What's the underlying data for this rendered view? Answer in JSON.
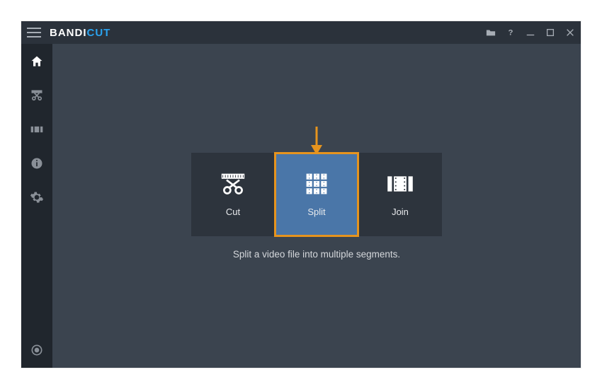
{
  "brand": {
    "part1": "BANDI",
    "part2": "CUT"
  },
  "titlebar": {
    "open": "Open",
    "help": "Help",
    "minimize": "Minimize",
    "maximize": "Maximize",
    "close": "Close"
  },
  "sidebar": {
    "home": "Home",
    "cut": "Cut",
    "join": "Join",
    "info": "Info",
    "settings": "Settings",
    "record": "Record"
  },
  "actions": {
    "cut": {
      "label": "Cut"
    },
    "split": {
      "label": "Split",
      "selected": true
    },
    "join": {
      "label": "Join"
    }
  },
  "caption": "Split a video file into multiple segments.",
  "annotation": {
    "arrow_target": "split"
  }
}
